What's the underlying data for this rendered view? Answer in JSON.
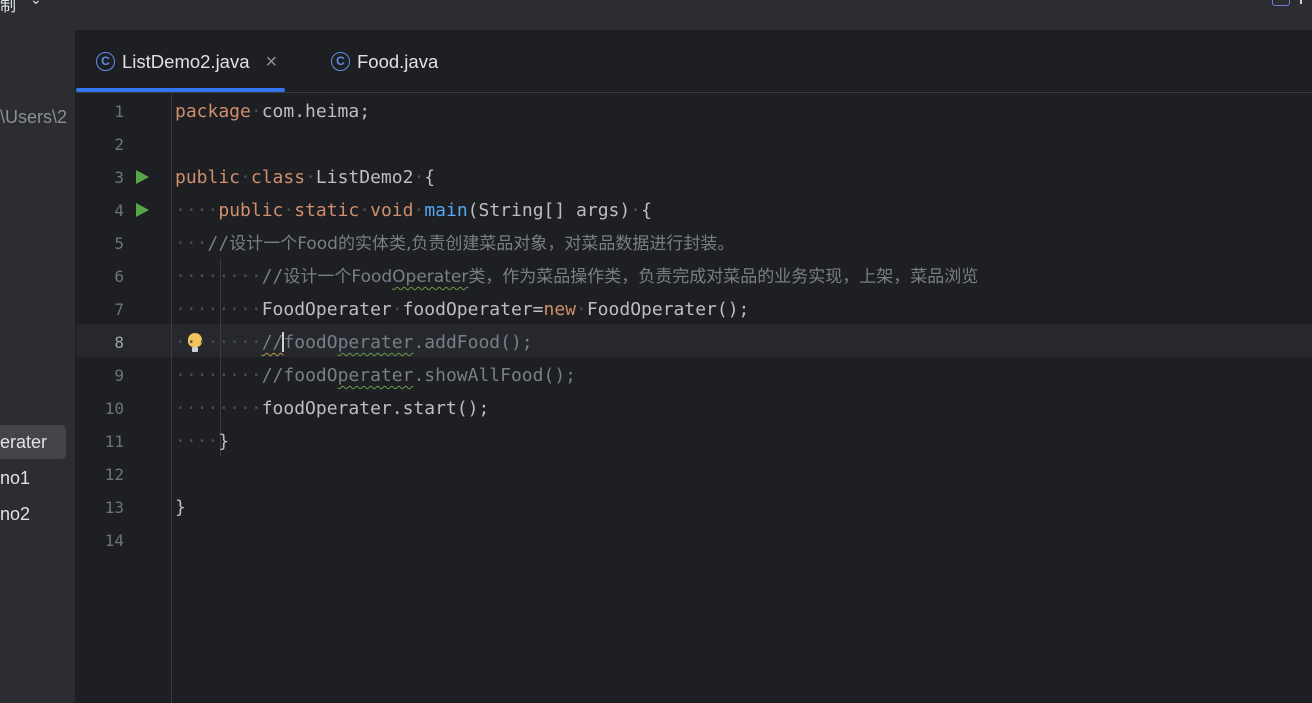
{
  "topbar": {
    "menu_fragment": "制",
    "chevron": "⌄"
  },
  "sidebar": {
    "path_fragment": "\\Users\\2",
    "tree_items": [
      {
        "label": "erater",
        "selected": true
      },
      {
        "label": "no1",
        "selected": false
      },
      {
        "label": "no2",
        "selected": false
      }
    ]
  },
  "tabs": [
    {
      "label": "ListDemo2.java",
      "icon": "class-icon",
      "icon_glyph": "C",
      "active": true,
      "close": "×"
    },
    {
      "label": "Food.java",
      "icon": "class-icon",
      "icon_glyph": "C",
      "active": false
    }
  ],
  "editor": {
    "active_line": 8,
    "line_numbers": [
      "1",
      "2",
      "3",
      "4",
      "5",
      "6",
      "7",
      "8",
      "9",
      "10",
      "11",
      "12",
      "13",
      "14"
    ],
    "lines": {
      "l1": {
        "kw_package": "package",
        "pkg": "com.heima;"
      },
      "l3": {
        "kw_public": "public",
        "kw_class": "class",
        "name": "ListDemo2",
        "brace": "{"
      },
      "l4": {
        "kw_public": "public",
        "kw_static": "static",
        "kw_void": "void",
        "method": "main",
        "params": "(String[] args)",
        "brace": "{"
      },
      "l5": {
        "comment_slash": "//",
        "comment_text": "设计一个Food的实体类,负责创建菜品对象，对菜品数据进行封装。"
      },
      "l6": {
        "comment_slash": "//",
        "comment_a": "设计一个Food",
        "comment_b": "Operater",
        "comment_c": "类，作为菜品操作类，负责完成对菜品的业务实现，上架，菜品浏览"
      },
      "l7": {
        "type": "FoodOperater",
        "var": "foodOperater",
        "eq": "=",
        "kw_new": "new",
        "ctor": "FoodOperater();"
      },
      "l8": {
        "comment_slash": "//",
        "var_a": "foodO",
        "var_b": "perater",
        "rest": ".addFood();"
      },
      "l9": {
        "comment_slash": "//",
        "var_a": "foodO",
        "var_b": "perater",
        "rest": ".showAllFood();"
      },
      "l10": {
        "stmt": "foodOperater.start();"
      },
      "l11": {
        "brace": "}"
      },
      "l13": {
        "brace": "}"
      }
    }
  },
  "colors": {
    "background": "#1e1f22",
    "keyword": "#cf8e6d",
    "function": "#56a8f5",
    "comment": "#7a7e85",
    "accent": "#3574f0",
    "run": "#57a64a"
  }
}
